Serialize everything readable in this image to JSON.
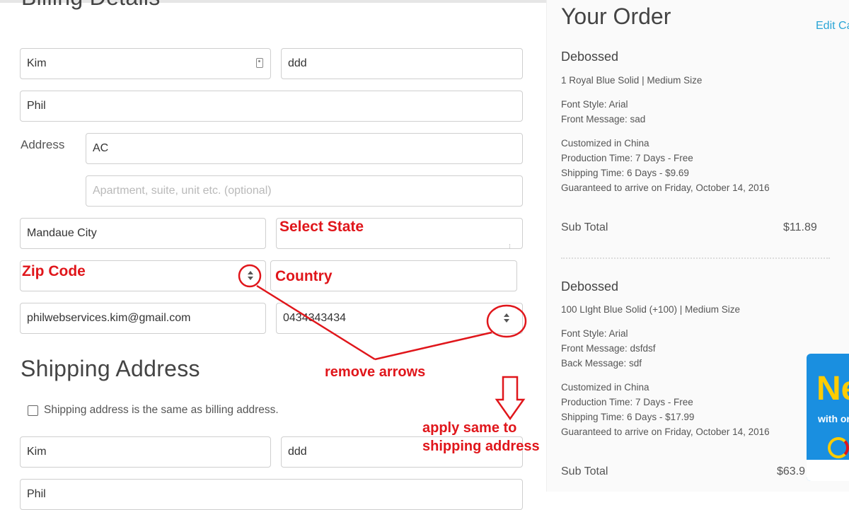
{
  "billing": {
    "title": "Billing Details",
    "first_name": "Kim",
    "last_name": "ddd",
    "company": "Phil",
    "address_label": "Address",
    "address1": "AC",
    "address2_placeholder": "Apartment, suite, unit etc. (optional)",
    "city": "Mandaue City",
    "email": "philwebservices.kim@gmail.com",
    "phone": "0434343434"
  },
  "shipping": {
    "title": "Shipping Address",
    "same_as_billing_label": "Shipping address is the same as billing address.",
    "same_as_billing_checked": false,
    "first_name": "Kim",
    "last_name": "ddd",
    "company": "Phil"
  },
  "annotations": {
    "select_state": "Select State",
    "zip_code": "Zip Code",
    "country": "Country",
    "remove_arrows": "remove arrows",
    "apply_same_line1": "apply same to",
    "apply_same_line2": "shipping address",
    "color": "#e0161b"
  },
  "order": {
    "title": "Your Order",
    "edit_link": "Edit Ca",
    "items": [
      {
        "name": "Debossed",
        "variant": "1 Royal Blue Solid | Medium Size",
        "font_style": "Font Style: Arial",
        "front_message": "Front Message: sad",
        "customized": "Customized in China",
        "production": "Production Time: 7 Days - Free",
        "shipping": "Shipping Time: 6 Days - $9.69",
        "guarantee": "Guaranteed to arrive on Friday, October 14, 2016",
        "subtotal_label": "Sub Total",
        "subtotal": "$11.89"
      },
      {
        "name": "Debossed",
        "variant": "100 LIght Blue Solid (+100) | Medium Size",
        "font_style": "Font Style: Arial",
        "front_message": "Front Message: dsfdsf",
        "back_message": "Back Message: sdf",
        "customized": "Customized in China",
        "production": "Production Time: 7 Days - Free",
        "shipping": "Shipping Time: 6 Days - $17.99",
        "guarantee": "Guaranteed to arrive on Friday, October 14, 2016",
        "subtotal_label": "Sub Total",
        "subtotal": "$63.9"
      }
    ]
  },
  "promo": {
    "headline": "Ne",
    "subtext": "with or"
  },
  "colors": {
    "link": "#2aa5d6",
    "promo_bg": "#1a8fe0",
    "promo_accent": "#ffcc00"
  }
}
